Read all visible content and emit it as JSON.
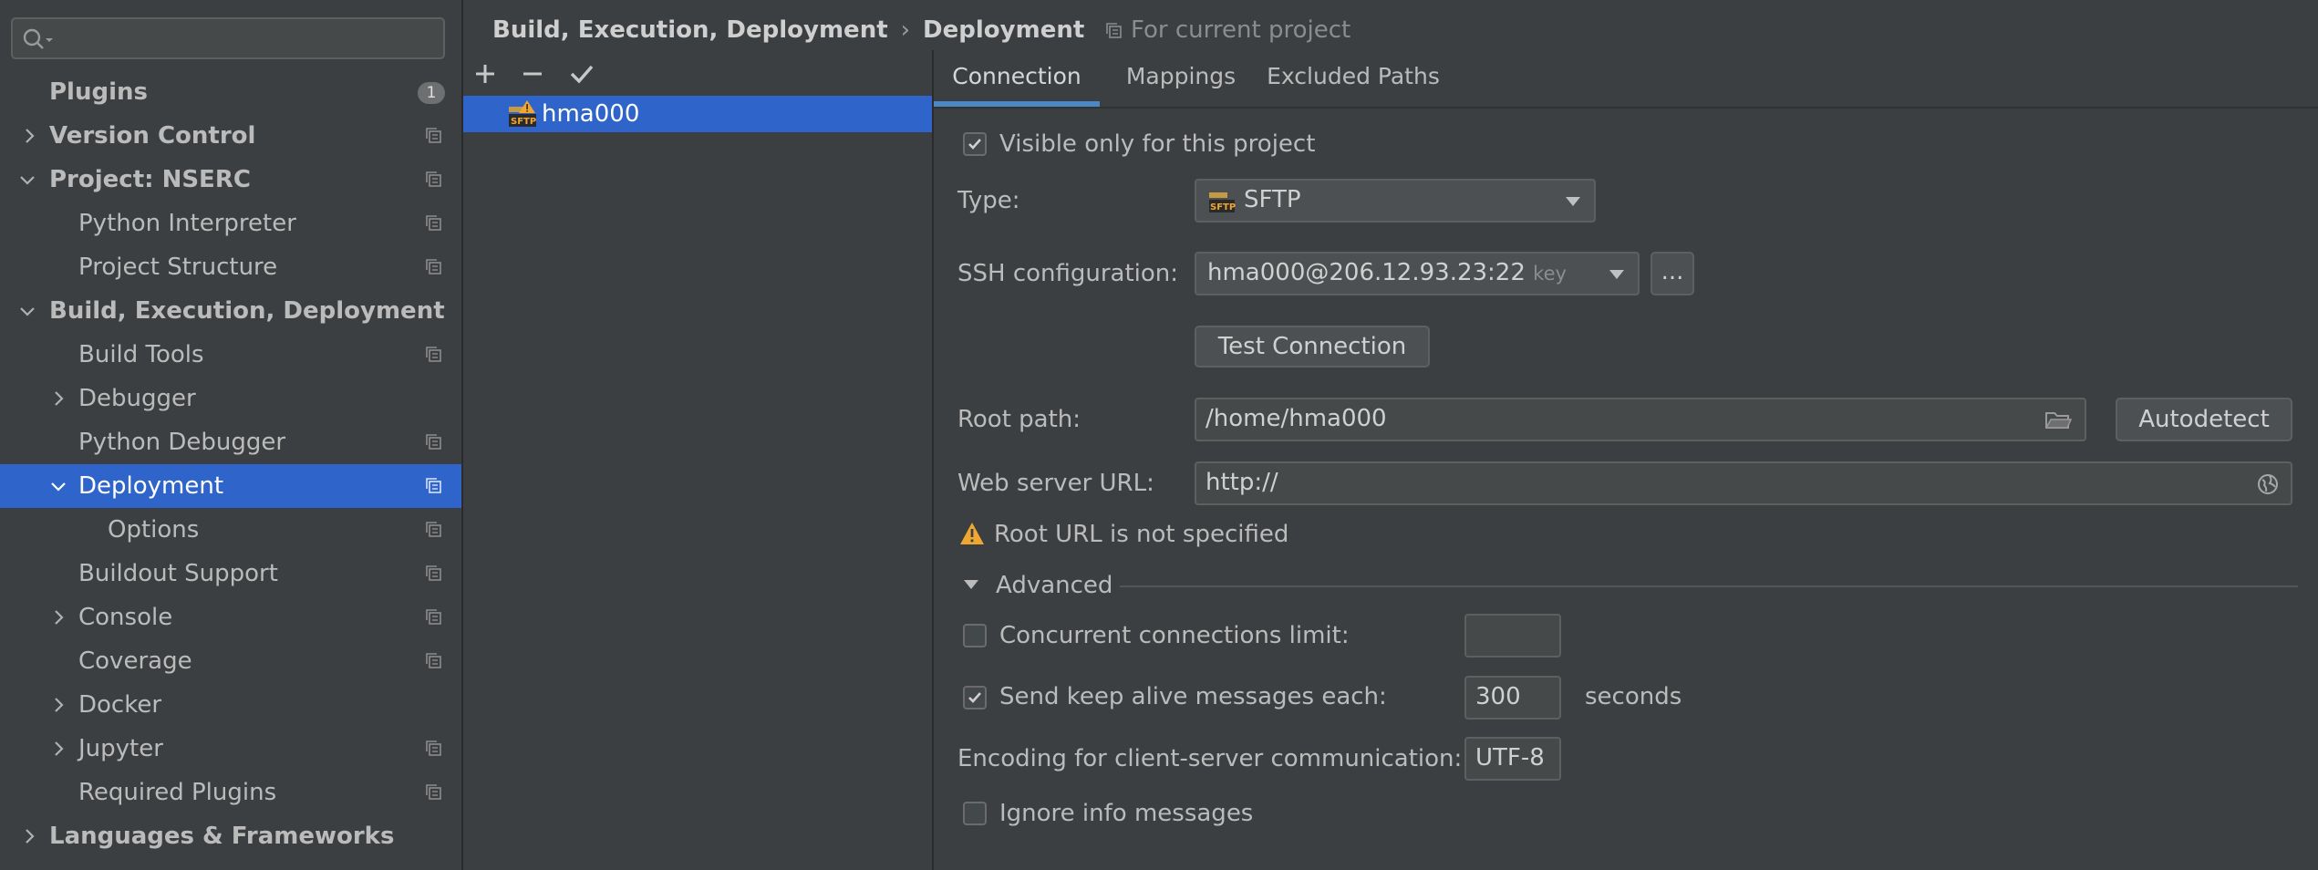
{
  "sidebar": {
    "search": {
      "value": "",
      "placeholder": ""
    },
    "items": [
      {
        "label": "Plugins",
        "badge": "1"
      },
      {
        "label": "Version Control"
      },
      {
        "label": "Project: NSERC"
      },
      {
        "label": "Python Interpreter"
      },
      {
        "label": "Project Structure"
      },
      {
        "label": "Build, Execution, Deployment"
      },
      {
        "label": "Build Tools"
      },
      {
        "label": "Debugger"
      },
      {
        "label": "Python Debugger"
      },
      {
        "label": "Deployment"
      },
      {
        "label": "Options"
      },
      {
        "label": "Buildout Support"
      },
      {
        "label": "Console"
      },
      {
        "label": "Coverage"
      },
      {
        "label": "Docker"
      },
      {
        "label": "Jupyter"
      },
      {
        "label": "Required Plugins"
      },
      {
        "label": "Languages & Frameworks"
      }
    ]
  },
  "header": {
    "breadcrumb": [
      "Build, Execution, Deployment",
      "Deployment"
    ],
    "separator": "›",
    "scope": "For current project"
  },
  "servers": {
    "items": [
      {
        "name": "hma000",
        "icon": "sftp-warning-icon"
      }
    ]
  },
  "tabs": [
    "Connection",
    "Mappings",
    "Excluded Paths"
  ],
  "connection": {
    "visible_only": {
      "label": "Visible only for this project",
      "checked": true
    },
    "type": {
      "label": "Type:",
      "value": "SFTP"
    },
    "ssh": {
      "label": "SSH configuration:",
      "value": "hma000@206.12.93.23:22",
      "suffix": "key",
      "more_button": "..."
    },
    "test_button": "Test Connection",
    "root_path": {
      "label": "Root path:",
      "value": "/home/hma000",
      "autodetect": "Autodetect"
    },
    "web_url": {
      "label": "Web server URL:",
      "value": "http://"
    },
    "warning": "Root URL is not specified",
    "advanced": {
      "title": "Advanced",
      "concurrent": {
        "label": "Concurrent connections limit:",
        "checked": false,
        "value": ""
      },
      "keep_alive": {
        "label": "Send keep alive messages each:",
        "checked": true,
        "value": "300",
        "unit": "seconds"
      },
      "encoding": {
        "label": "Encoding for client-server communication:",
        "value": "UTF-8"
      },
      "ignore_info": {
        "label": "Ignore info messages",
        "checked": false
      }
    }
  },
  "colors": {
    "background": "#3c3f41",
    "selection": "#2f65ca",
    "accent": "#4a88c7",
    "warning": "#f0a732"
  }
}
